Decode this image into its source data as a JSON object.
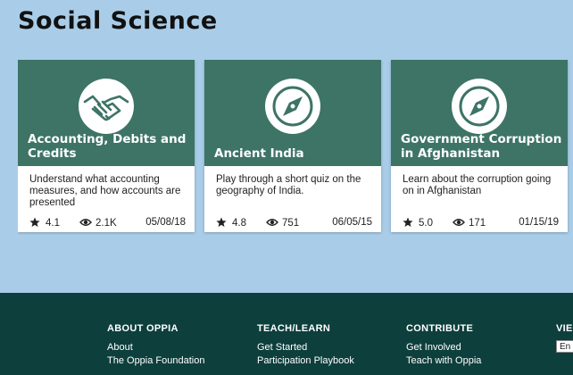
{
  "section": {
    "title": "Social Science"
  },
  "cards": [
    {
      "title": "Accounting, Debits and Credits",
      "icon": "handshake-icon",
      "description": "Understand what accounting measures, and how accounts are presented",
      "rating": "4.1",
      "views": "2.1K",
      "date": "05/08/18"
    },
    {
      "title": "Ancient India",
      "icon": "compass-icon",
      "description": "Play through a short quiz on the geography of India.",
      "rating": "4.8",
      "views": "751",
      "date": "06/05/15"
    },
    {
      "title": "Government Corruption in Afghanistan",
      "icon": "compass-icon",
      "description": "Learn about the corruption going on in Afghanistan",
      "rating": "5.0",
      "views": "171",
      "date": "01/15/19"
    }
  ],
  "footer": {
    "columns": [
      {
        "heading": "ABOUT OPPIA",
        "links": [
          "About",
          "The Oppia Foundation"
        ]
      },
      {
        "heading": "TEACH/LEARN",
        "links": [
          "Get Started",
          "Participation Playbook"
        ]
      },
      {
        "heading": "CONTRIBUTE",
        "links": [
          "Get Involved",
          "Teach with Oppia"
        ]
      },
      {
        "heading": "VIE",
        "language_value": "En"
      }
    ]
  },
  "colors": {
    "background": "#a9cde8",
    "card_header": "#3d7466",
    "footer": "#0d3f3c"
  }
}
